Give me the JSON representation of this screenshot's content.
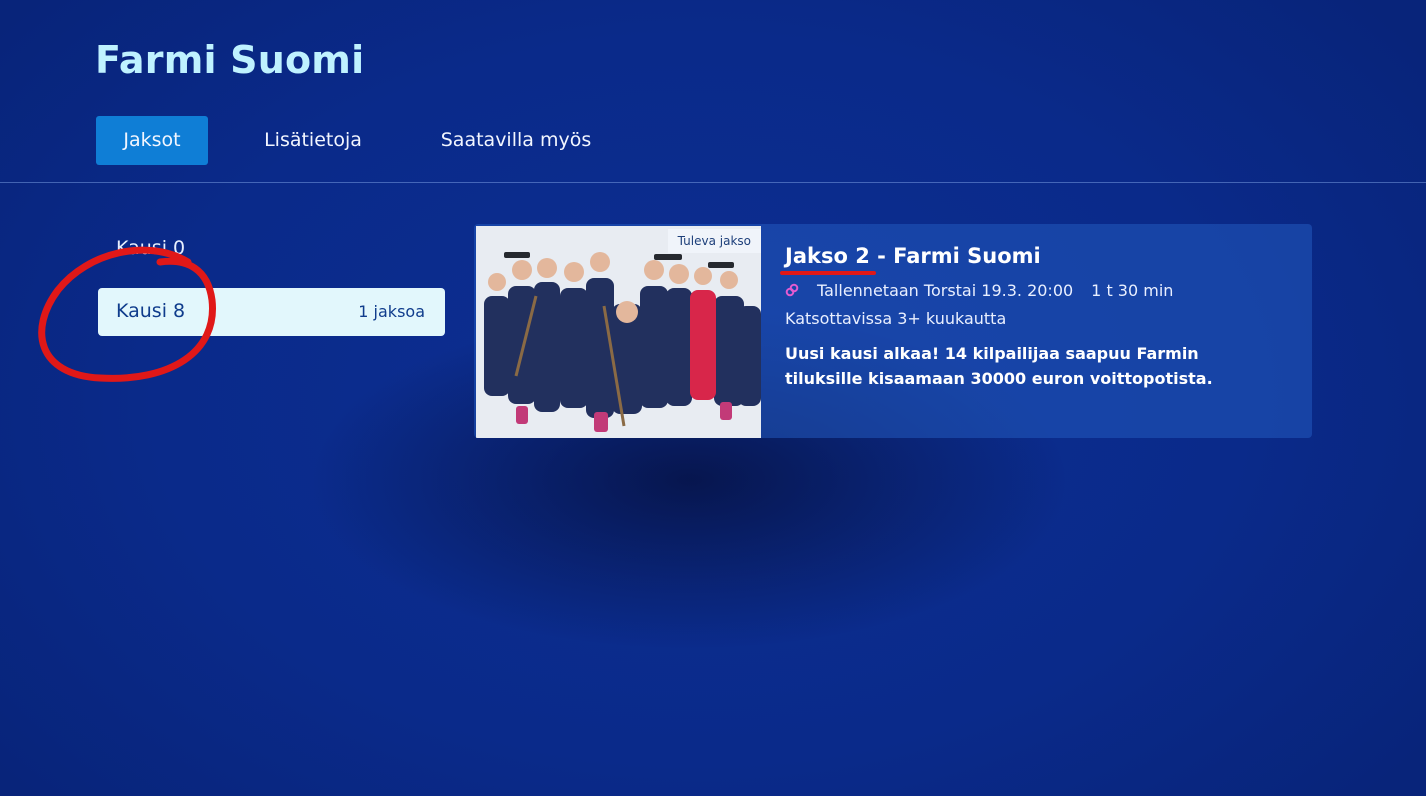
{
  "page": {
    "title": "Farmi Suomi"
  },
  "tabs": [
    {
      "label": "Jaksot",
      "active": true
    },
    {
      "label": "Lisätietoja",
      "active": false
    },
    {
      "label": "Saatavilla myös",
      "active": false
    }
  ],
  "seasons": [
    {
      "label": "Kausi 0",
      "count": ""
    },
    {
      "label": "Kausi 8",
      "count": "1 jaksoa",
      "selected": true
    }
  ],
  "episode": {
    "badge": "Tuleva jakso",
    "title": "Jakso 2 - Farmi Suomi",
    "record_icon": "record-link-icon",
    "record_text": "Tallennetaan Torstai 19.3. 20:00",
    "duration": "1 t 30 min",
    "availability": "Katsottavissa 3+ kuukautta",
    "description": "Uusi kausi alkaa! 14 kilpailijaa saapuu Farmin tiluksille kisaamaan 30000 euron voittopotista."
  },
  "colors": {
    "accent": "#0f7ed6",
    "title": "#bff2ff",
    "annotation": "#e01818"
  }
}
